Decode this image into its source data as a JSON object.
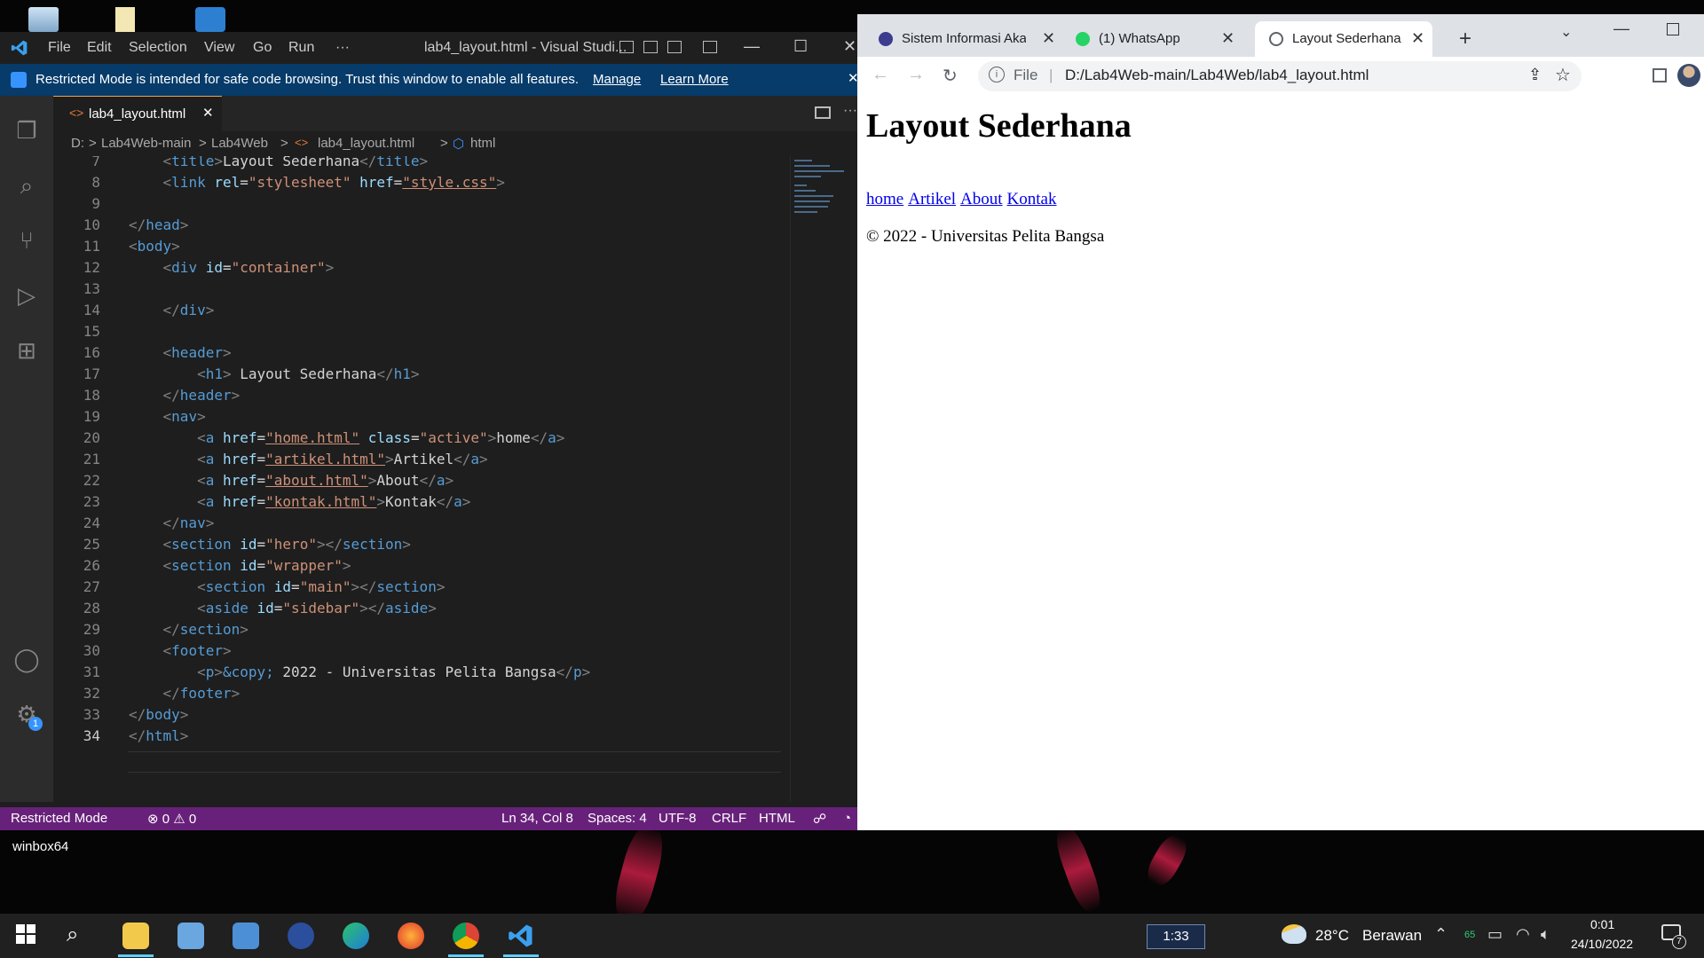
{
  "desktop": {
    "label": "winbox64"
  },
  "vscode": {
    "menu": [
      "File",
      "Edit",
      "Selection",
      "View",
      "Go",
      "Run",
      "···"
    ],
    "window_title": "lab4_layout.html - Visual Studi...",
    "banner": {
      "text": "Restricted Mode is intended for safe code browsing. Trust this window to enable all features.",
      "manage": "Manage",
      "learn_more": "Learn More"
    },
    "tab": {
      "label": "lab4_layout.html",
      "close": "✕"
    },
    "breadcrumb": [
      "D:",
      ">",
      "Lab4Web-main",
      ">",
      "Lab4Web",
      ">",
      "lab4_layout.html",
      ">",
      "html"
    ],
    "code": [
      {
        "n": "7"
      },
      {
        "n": "8"
      },
      {
        "n": "9"
      },
      {
        "n": "10"
      },
      {
        "n": "11"
      },
      {
        "n": "12"
      },
      {
        "n": "13"
      },
      {
        "n": "14"
      },
      {
        "n": "15"
      },
      {
        "n": "16"
      },
      {
        "n": "17"
      },
      {
        "n": "18"
      },
      {
        "n": "19"
      },
      {
        "n": "20"
      },
      {
        "n": "21"
      },
      {
        "n": "22"
      },
      {
        "n": "23"
      },
      {
        "n": "24"
      },
      {
        "n": "25"
      },
      {
        "n": "26"
      },
      {
        "n": "27"
      },
      {
        "n": "28"
      },
      {
        "n": "29"
      },
      {
        "n": "30"
      },
      {
        "n": "31"
      },
      {
        "n": "32"
      },
      {
        "n": "33"
      },
      {
        "n": "34"
      }
    ],
    "code_text": {
      "l7_tag": "title",
      "l7_text": "Layout Sederhana",
      "l8_attr1": "rel",
      "l8_val1": "\"stylesheet\"",
      "l8_attr2": "href",
      "l8_val2": "\"style.css\"",
      "l12_val": "\"container\"",
      "l17_text": " Layout Sederhana",
      "l20_val1": "\"home.html\"",
      "l20_val2": "\"active\"",
      "l20_text": "home",
      "l21_val": "\"artikel.html\"",
      "l21_text": "Artikel",
      "l22_val": "\"about.html\"",
      "l22_text": "About",
      "l23_val": "\"kontak.html\"",
      "l23_text": "Kontak",
      "l25_val": "\"hero\"",
      "l26_val": "\"wrapper\"",
      "l27_val": "\"main\"",
      "l28_val": "\"sidebar\"",
      "l31_entity": "&copy;",
      "l31_text": " 2022 - Universitas Pelita Bangsa"
    },
    "status": {
      "mode": "Restricted Mode",
      "problems": "⊗ 0 ⚠ 0",
      "position": "Ln 34, Col 8",
      "spaces": "Spaces: 4",
      "encoding": "UTF-8",
      "eol": "CRLF",
      "language": "HTML"
    },
    "accounts_badge": "1"
  },
  "chrome": {
    "tabs": [
      {
        "label": "Sistem Informasi Aka",
        "close": "✕"
      },
      {
        "label": "(1) WhatsApp",
        "close": "✕"
      },
      {
        "label": "Layout Sederhana",
        "close": "✕"
      }
    ],
    "new_tab": "+",
    "omnibox": {
      "scheme_label": "File",
      "separator": "|",
      "url": "D:/Lab4Web-main/Lab4Web/lab4_layout.html"
    },
    "page": {
      "heading": "Layout Sederhana",
      "nav": [
        "home",
        "Artikel",
        "About",
        "Kontak"
      ],
      "footer": "© 2022 - Universitas Pelita Bangsa"
    }
  },
  "taskbar": {
    "clock_pill": "1:33",
    "weather_temp": "28°C",
    "weather_desc": "Berawan",
    "battery_badge": "65",
    "time": "0:01",
    "date": "24/10/2022",
    "notification_count": "7"
  },
  "colors": {
    "vscode_status": "#68217a",
    "banner": "#063b6a",
    "chrome_strip": "#dee1e6",
    "link": "#0000ee"
  }
}
